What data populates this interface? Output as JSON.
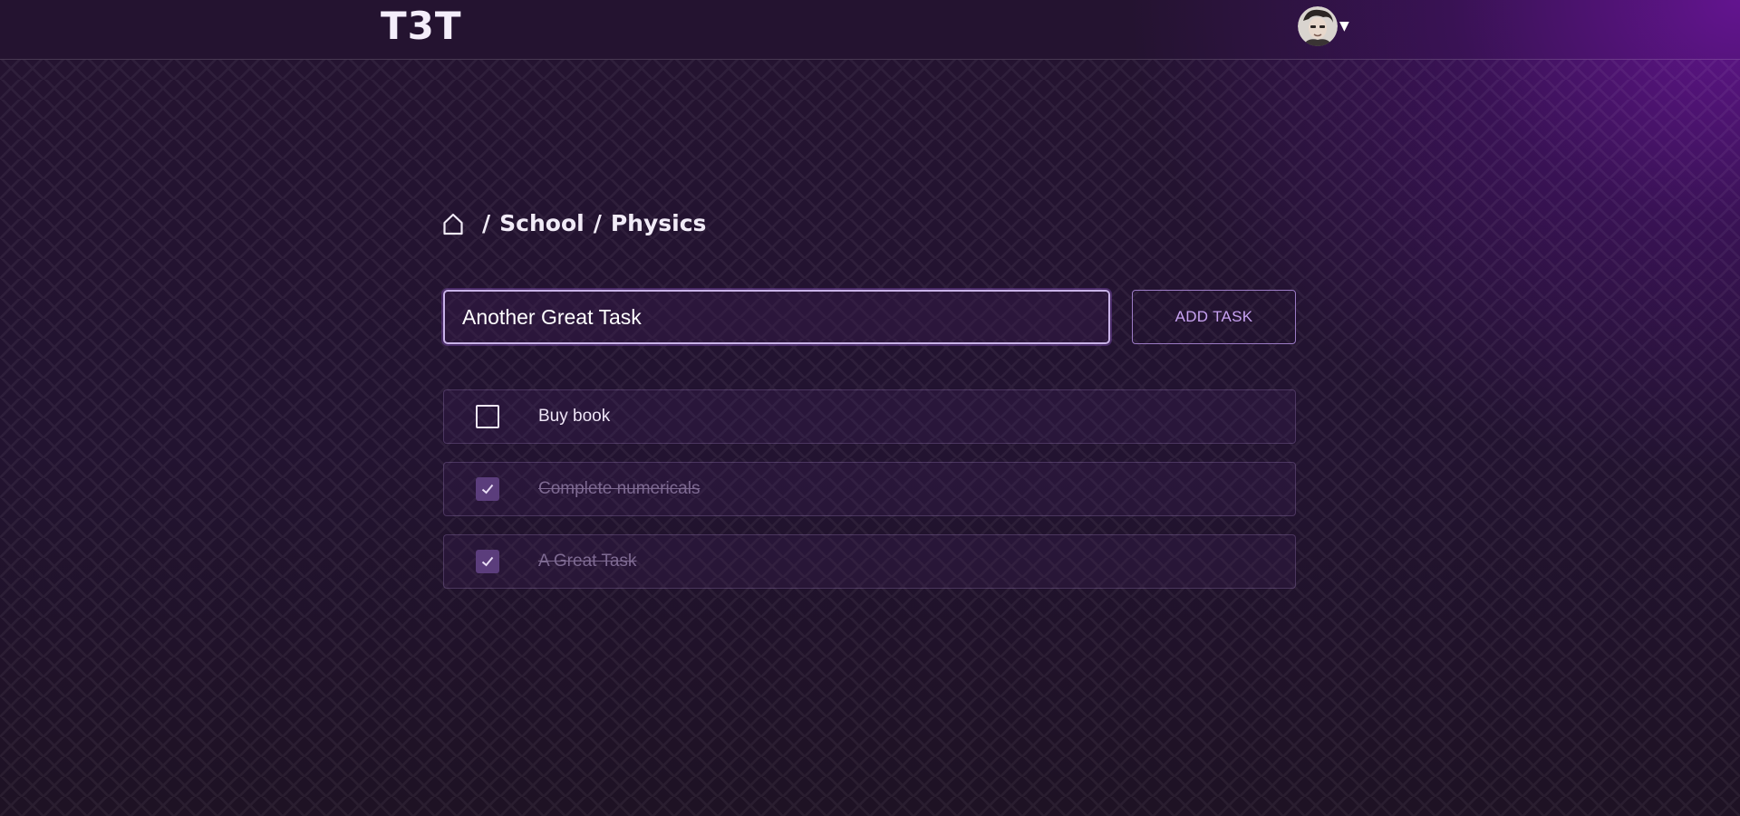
{
  "header": {
    "logo": "T3T",
    "user": {
      "avatar": "avatar",
      "menu_icon": "caret-down-icon"
    }
  },
  "breadcrumb": {
    "home_icon": "home-icon",
    "items": [
      {
        "label": "School"
      },
      {
        "label": "Physics"
      }
    ],
    "separator": "/"
  },
  "new_task": {
    "value": "Another Great Task",
    "add_label": "ADD TASK"
  },
  "tasks": [
    {
      "label": "Buy book",
      "done": false
    },
    {
      "label": "Complete numericals",
      "done": true
    },
    {
      "label": "A Great Task",
      "done": true
    }
  ],
  "colors": {
    "accent": "#c8a2f2",
    "checked_box": "#5b3d7c",
    "background": "#221330"
  }
}
